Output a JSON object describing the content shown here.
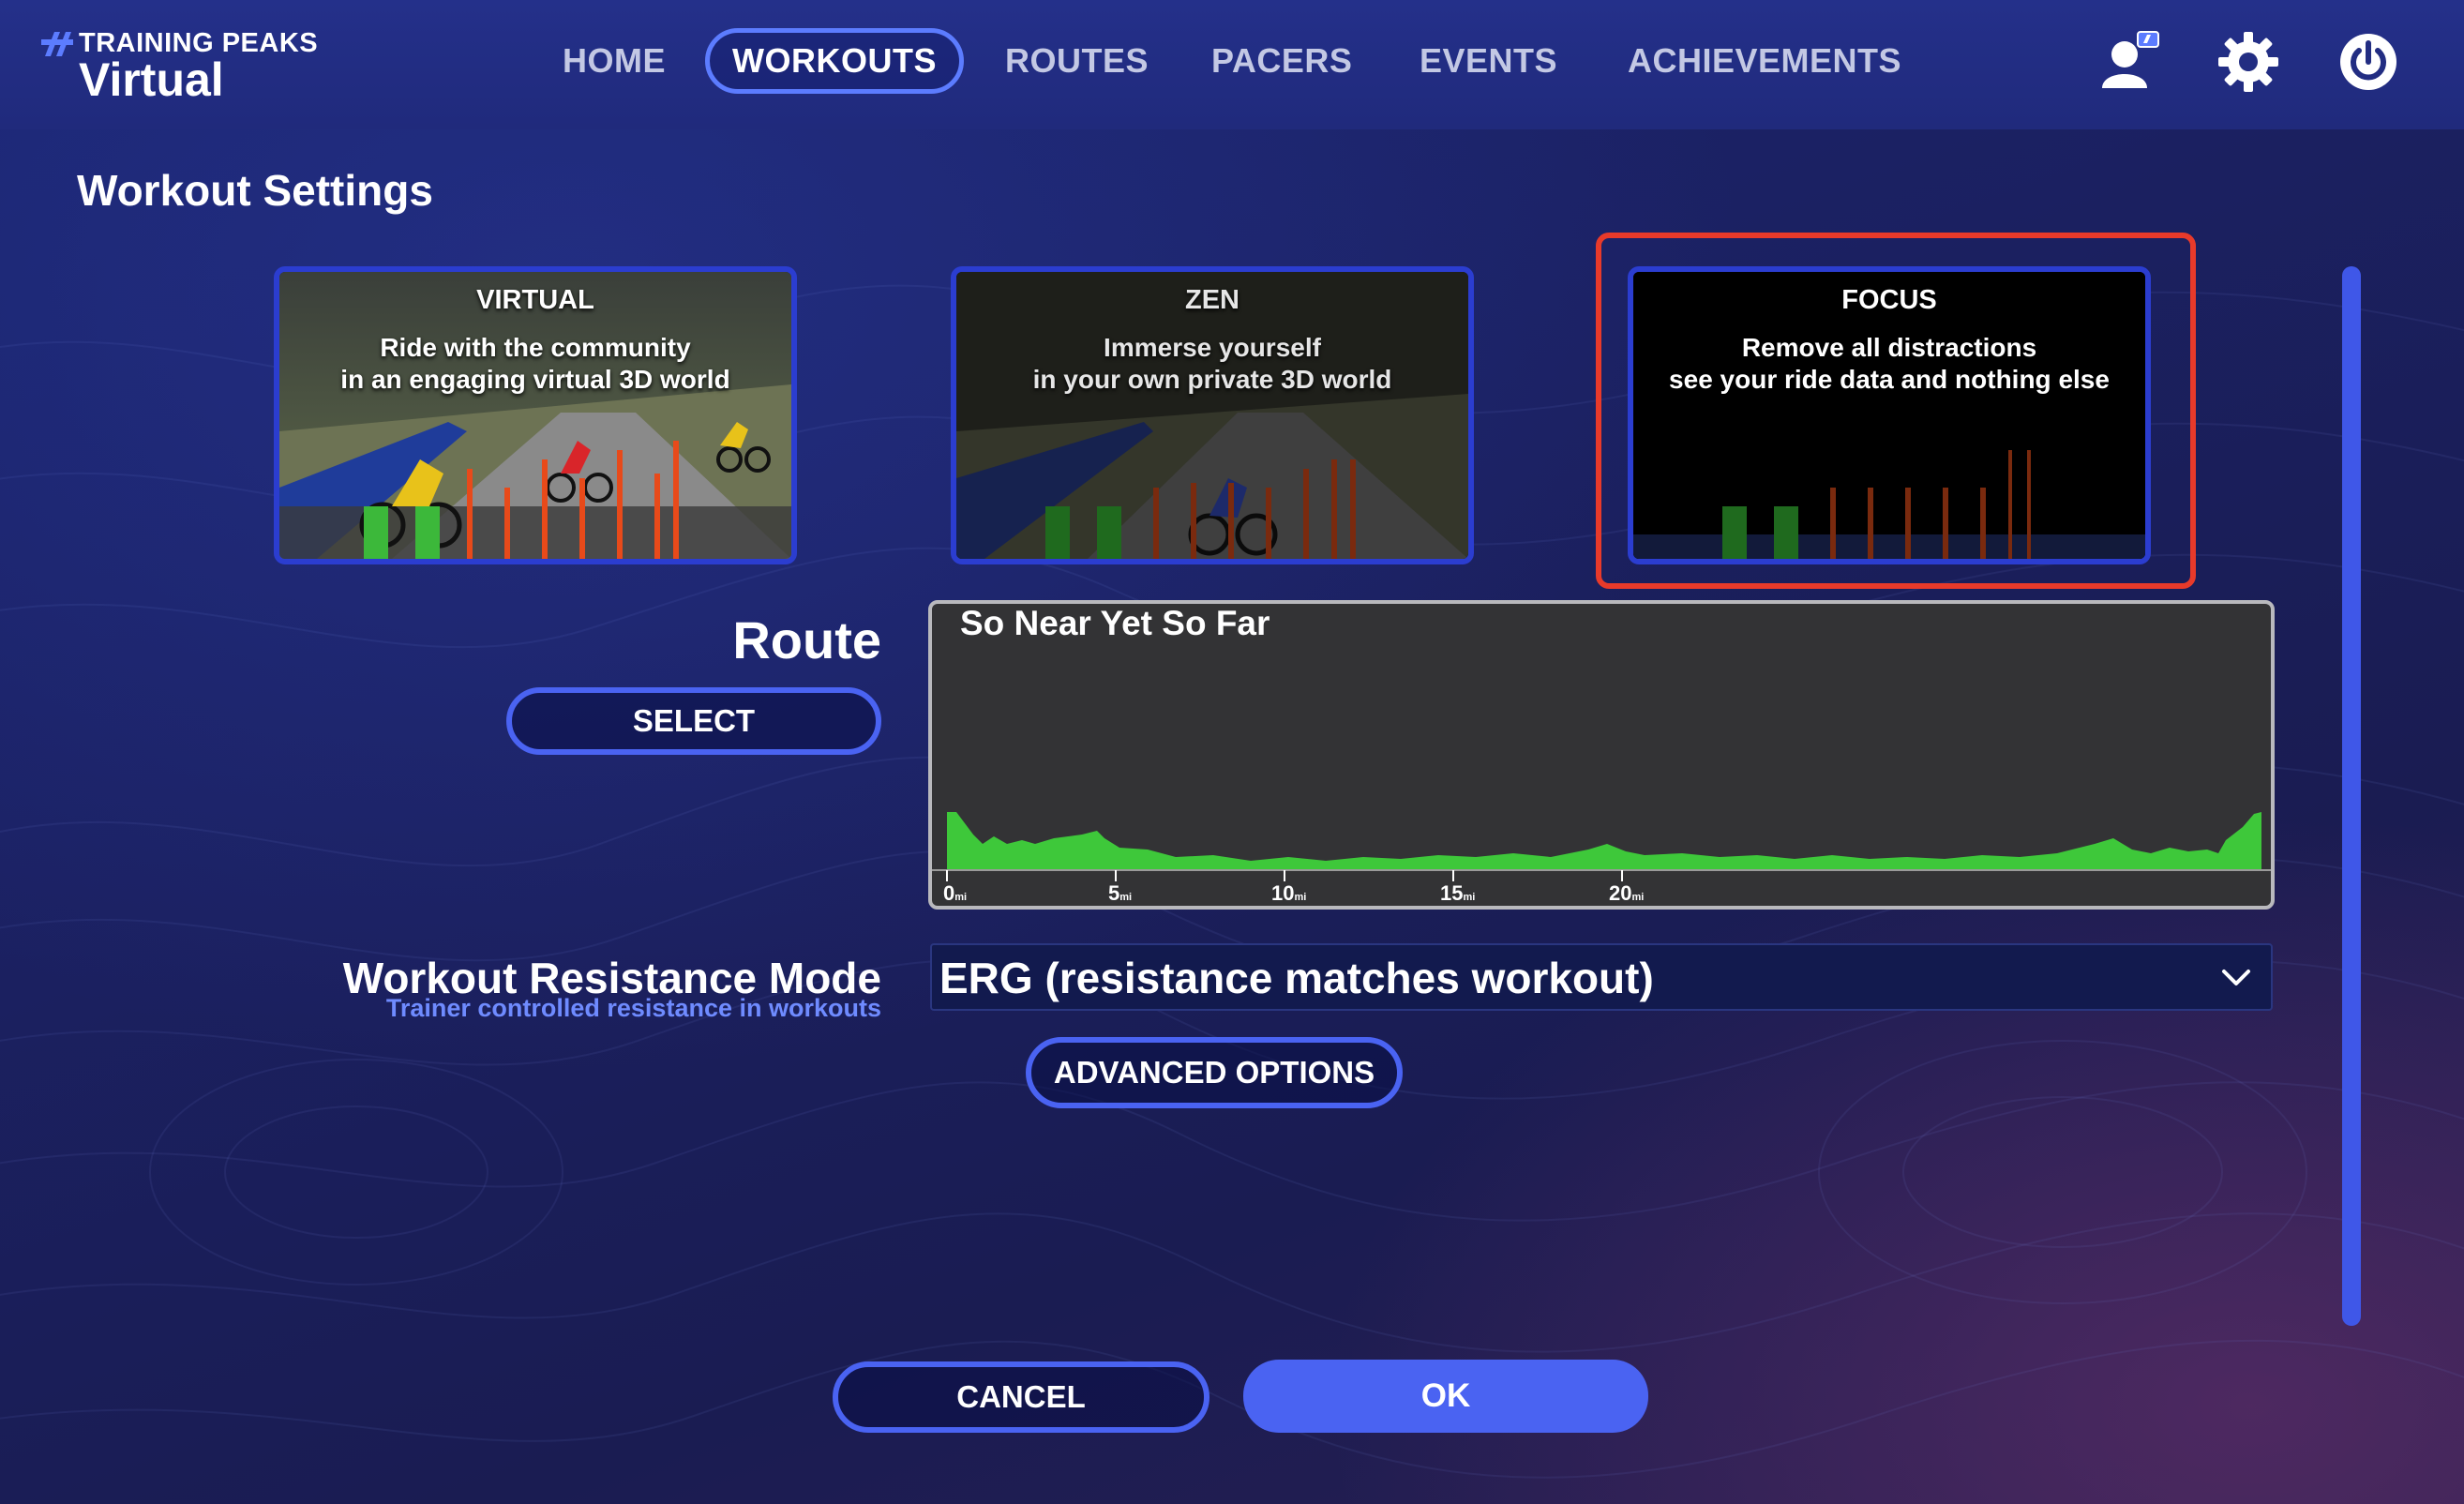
{
  "app": {
    "logo_top": "TRAINING PEAKS",
    "logo_bottom": "Virtual"
  },
  "nav": {
    "items": [
      {
        "label": "HOME",
        "active": false
      },
      {
        "label": "WORKOUTS",
        "active": true
      },
      {
        "label": "ROUTES",
        "active": false
      },
      {
        "label": "PACERS",
        "active": false
      },
      {
        "label": "EVENTS",
        "active": false
      },
      {
        "label": "ACHIEVEMENTS",
        "active": false
      }
    ],
    "icons": [
      "profile-icon",
      "gear-icon",
      "power-icon"
    ]
  },
  "page": {
    "title": "Workout Settings"
  },
  "modes": [
    {
      "title": "VIRTUAL",
      "desc_line1": "Ride with the community",
      "desc_line2": "in an engaging virtual 3D world"
    },
    {
      "title": "ZEN",
      "desc_line1": "Immerse yourself",
      "desc_line2": "in your own private 3D world"
    },
    {
      "title": "FOCUS",
      "desc_line1": "Remove all distractions",
      "desc_line2": "see your ride data and nothing else",
      "highlighted": true
    }
  ],
  "route": {
    "label": "Route",
    "select_label": "SELECT",
    "name": "So Near Yet So Far",
    "ticks": [
      {
        "value": "0",
        "unit": "mi"
      },
      {
        "value": "5",
        "unit": "mi"
      },
      {
        "value": "10",
        "unit": "mi"
      },
      {
        "value": "15",
        "unit": "mi"
      },
      {
        "value": "20",
        "unit": "mi"
      }
    ]
  },
  "resistance": {
    "label": "Workout Resistance Mode",
    "sublabel": "Trainer controlled resistance in workouts",
    "selected": "ERG (resistance matches workout)",
    "advanced_label": "ADVANCED OPTIONS"
  },
  "actions": {
    "cancel_label": "CANCEL",
    "ok_label": "OK"
  },
  "colors": {
    "accent": "#4a63f2",
    "highlight": "#e83a2a",
    "profile_fill": "#3ec83a",
    "header": "#222d82"
  }
}
